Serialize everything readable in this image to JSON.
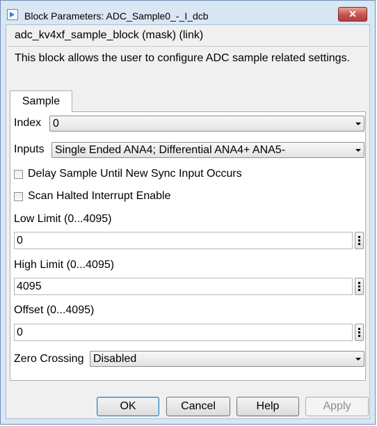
{
  "window": {
    "title": "Block Parameters: ADC_Sample0_-_I_dcb",
    "close_glyph": "✕"
  },
  "mask": {
    "title": "adc_kv4xf_sample_block (mask) (link)",
    "description": "This block allows the user to configure ADC sample related settings."
  },
  "tabs": [
    {
      "label": "Sample",
      "selected": true
    }
  ],
  "params": {
    "index": {
      "label": "Index",
      "value": "0"
    },
    "inputs": {
      "label": "Inputs",
      "value": "Single Ended ANA4; Differential ANA4+ ANA5-"
    },
    "delay_sample": {
      "label": "Delay Sample Until New Sync Input Occurs",
      "checked": false
    },
    "scan_halted": {
      "label": "Scan Halted Interrupt Enable",
      "checked": false
    },
    "low_limit": {
      "label": "Low Limit (0...4095)",
      "value": "0"
    },
    "high_limit": {
      "label": "High Limit (0...4095)",
      "value": "4095"
    },
    "offset": {
      "label": "Offset (0...4095)",
      "value": "0"
    },
    "zero_crossing": {
      "label": "Zero Crossing",
      "value": "Disabled"
    }
  },
  "buttons": {
    "ok": "OK",
    "cancel": "Cancel",
    "help": "Help",
    "apply": "Apply"
  },
  "colors": {
    "frame": "#d9e6f3",
    "close_button": "#c75050",
    "default_button_border": "#3c7fb1"
  },
  "icons": [
    "simulink-block-icon",
    "close-icon",
    "chevron-down-icon",
    "ellipsis-vertical-icon"
  ]
}
